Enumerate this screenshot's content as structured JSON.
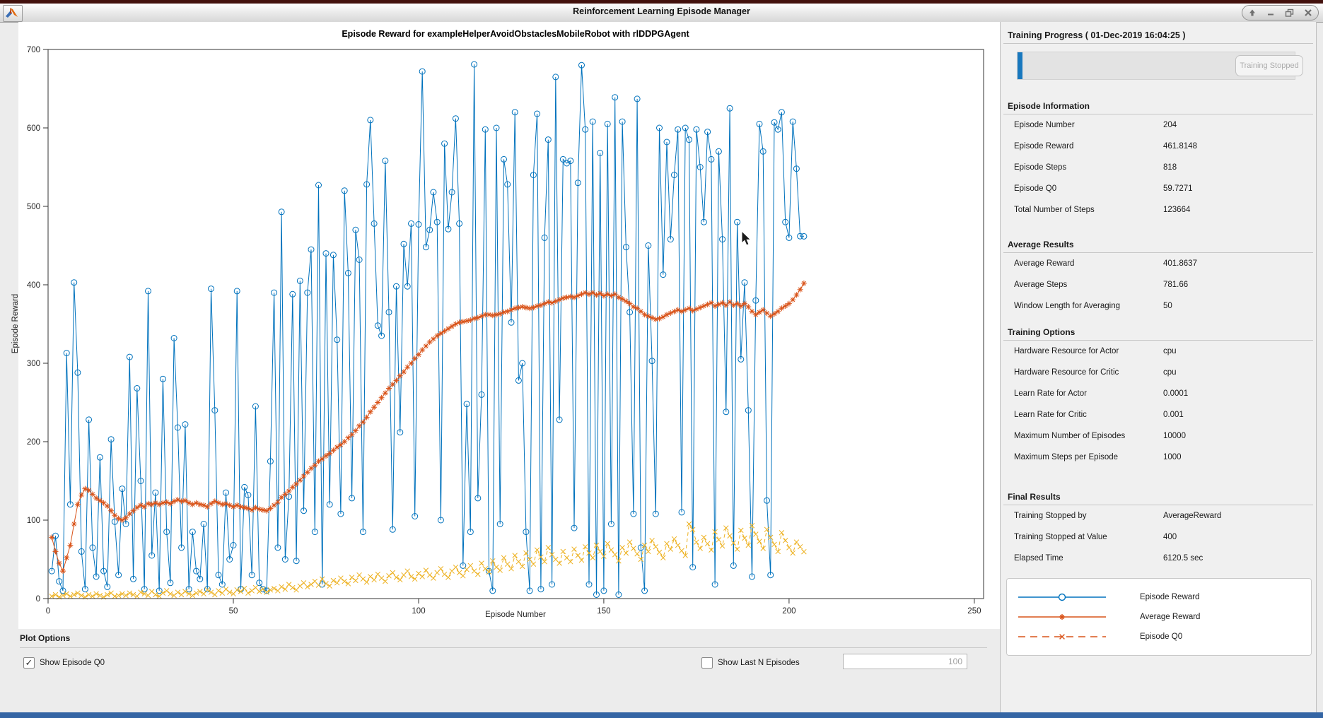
{
  "window": {
    "title": "Reinforcement Learning Episode Manager"
  },
  "chart": {
    "title": "Episode Reward for exampleHelperAvoidObstaclesMobileRobot with rlDDPGAgent",
    "xlabel": "Episode Number",
    "ylabel": "Episode Reward"
  },
  "chart_data": {
    "type": "line",
    "title": "Episode Reward for exampleHelperAvoidObstaclesMobileRobot with rlDDPGAgent",
    "xlabel": "Episode Number",
    "ylabel": "Episode Reward",
    "xlim": [
      0,
      252.5
    ],
    "ylim": [
      0,
      700
    ],
    "xticks": [
      0,
      50,
      100,
      150,
      200,
      250
    ],
    "yticks": [
      0,
      100,
      200,
      300,
      400,
      500,
      600,
      700
    ],
    "grid": false,
    "legend_position": "right-panel",
    "series": [
      {
        "name": "Episode Reward",
        "color": "#0072BD",
        "marker": "circle",
        "style": "solid",
        "values": [
          35,
          80,
          22,
          10,
          313,
          120,
          403,
          288,
          60,
          12,
          228,
          65,
          28,
          180,
          35,
          15,
          203,
          98,
          30,
          140,
          95,
          308,
          25,
          268,
          150,
          12,
          392,
          55,
          135,
          10,
          280,
          85,
          20,
          332,
          218,
          65,
          222,
          12,
          85,
          35,
          25,
          95,
          12,
          395,
          240,
          30,
          18,
          135,
          50,
          68,
          392,
          12,
          142,
          132,
          30,
          245,
          20,
          12,
          10,
          175,
          390,
          65,
          493,
          50,
          130,
          388,
          48,
          405,
          112,
          390,
          445,
          85,
          527,
          18,
          440,
          120,
          438,
          330,
          108,
          520,
          415,
          128,
          470,
          432,
          85,
          528,
          610,
          478,
          348,
          335,
          558,
          365,
          88,
          398,
          212,
          452,
          398,
          478,
          105,
          477,
          672,
          448,
          470,
          518,
          480,
          100,
          580,
          471,
          518,
          612,
          478,
          42,
          248,
          85,
          681,
          128,
          260,
          598,
          35,
          10,
          600,
          95,
          560,
          528,
          352,
          620,
          278,
          300,
          85,
          10,
          540,
          618,
          12,
          460,
          585,
          18,
          665,
          228,
          560,
          555,
          558,
          90,
          530,
          680,
          598,
          18,
          608,
          5,
          568,
          10,
          605,
          95,
          639,
          5,
          608,
          448,
          365,
          108,
          637,
          65,
          10,
          450,
          303,
          108,
          600,
          413,
          582,
          458,
          540,
          598,
          110,
          600,
          585,
          40,
          598,
          550,
          480,
          595,
          560,
          18,
          570,
          458,
          238,
          625,
          42,
          480,
          305,
          403,
          240,
          28,
          380,
          605,
          570,
          125,
          30,
          607,
          598,
          620,
          480,
          460,
          608,
          548,
          462,
          461.8148
        ]
      },
      {
        "name": "Average Reward",
        "color": "#D95319",
        "marker": "asterisk",
        "style": "solid",
        "values": [
          78,
          60,
          45,
          35,
          52,
          68,
          95,
          120,
          132,
          140,
          138,
          133,
          128,
          125,
          122,
          118,
          112,
          106,
          102,
          100,
          103,
          108,
          112,
          116,
          119,
          117,
          121,
          120,
          122,
          120,
          122,
          123,
          121,
          124,
          126,
          124,
          125,
          122,
          120,
          122,
          120,
          119,
          117,
          121,
          124,
          122,
          120,
          121,
          119,
          117,
          119,
          117,
          116,
          115,
          113,
          116,
          114,
          113,
          112,
          115,
          119,
          123,
          129,
          133,
          137,
          142,
          146,
          151,
          156,
          161,
          166,
          170,
          175,
          178,
          182,
          185,
          189,
          193,
          196,
          200,
          205,
          209,
          214,
          220,
          225,
          231,
          238,
          244,
          250,
          256,
          262,
          268,
          273,
          278,
          284,
          289,
          295,
          300,
          306,
          311,
          317,
          322,
          327,
          331,
          335,
          338,
          341,
          344,
          347,
          350,
          352,
          353,
          354,
          355,
          357,
          358,
          360,
          362,
          362,
          361,
          362,
          363,
          365,
          366,
          368,
          370,
          371,
          372,
          371,
          370,
          371,
          373,
          374,
          376,
          378,
          377,
          379,
          381,
          383,
          384,
          385,
          384,
          386,
          388,
          390,
          388,
          390,
          387,
          389,
          386,
          388,
          386,
          388,
          384,
          382,
          379,
          376,
          372,
          370,
          366,
          362,
          360,
          358,
          356,
          357,
          359,
          362,
          364,
          366,
          368,
          366,
          368,
          370,
          367,
          369,
          371,
          373,
          375,
          377,
          373,
          375,
          377,
          374,
          378,
          374,
          376,
          373,
          376,
          372,
          366,
          362,
          365,
          368,
          364,
          360,
          363,
          366,
          370,
          373,
          376,
          381,
          387,
          394,
          401.8637
        ]
      },
      {
        "name": "Episode Q0",
        "color": "#EDB120",
        "marker": "x",
        "style": "dashed",
        "values": [
          3,
          5,
          2,
          4,
          6,
          3,
          5,
          7,
          4,
          2,
          5,
          3,
          6,
          4,
          2,
          5,
          7,
          3,
          4,
          6,
          4,
          7,
          5,
          3,
          8,
          6,
          4,
          9,
          5,
          3,
          7,
          10,
          6,
          4,
          8,
          5,
          9,
          6,
          4,
          7,
          9,
          6,
          11,
          8,
          5,
          10,
          7,
          12,
          8,
          6,
          11,
          9,
          13,
          7,
          10,
          14,
          9,
          12,
          8,
          11,
          13,
          10,
          15,
          12,
          18,
          14,
          11,
          16,
          20,
          15,
          18,
          22,
          17,
          25,
          19,
          16,
          23,
          20,
          26,
          22,
          19,
          27,
          23,
          30,
          25,
          21,
          28,
          24,
          31,
          26,
          22,
          29,
          33,
          27,
          24,
          30,
          35,
          28,
          25,
          32,
          28,
          36,
          30,
          26,
          33,
          38,
          31,
          27,
          35,
          40,
          33,
          29,
          37,
          42,
          35,
          31,
          45,
          38,
          34,
          48,
          40,
          36,
          52,
          44,
          38,
          55,
          47,
          41,
          58,
          50,
          44,
          62,
          53,
          47,
          65,
          56,
          50,
          45,
          60,
          52,
          47,
          63,
          55,
          49,
          66,
          58,
          52,
          68,
          60,
          54,
          70,
          62,
          56,
          48,
          65,
          58,
          72,
          64,
          57,
          50,
          68,
          60,
          74,
          66,
          59,
          52,
          70,
          63,
          76,
          68,
          61,
          55,
          95,
          88,
          72,
          64,
          78,
          70,
          62,
          85,
          75,
          67,
          90,
          80,
          71,
          63,
          87,
          77,
          68,
          93,
          82,
          73,
          64,
          88,
          78,
          69,
          60,
          84,
          74,
          65,
          58,
          72,
          66,
          59.7271
        ]
      }
    ]
  },
  "plot_options": {
    "header": "Plot Options",
    "show_episode_q0": {
      "label": "Show Episode Q0",
      "checked": true
    },
    "show_last_n": {
      "label": "Show Last N Episodes",
      "checked": false
    },
    "n_value": "100"
  },
  "panel": {
    "header": "Training Progress ( 01-Dec-2019 16:04:25 )",
    "progress_button": "Training Stopped",
    "sections": [
      {
        "title": "Episode Information",
        "rows": [
          [
            "Episode Number",
            "204"
          ],
          [
            "Episode Reward",
            "461.8148"
          ],
          [
            "Episode Steps",
            "818"
          ],
          [
            "Episode Q0",
            "59.7271"
          ],
          [
            "Total Number of Steps",
            "123664"
          ]
        ]
      },
      {
        "title": "Average Results",
        "rows": [
          [
            "Average Reward",
            "401.8637"
          ],
          [
            "Average Steps",
            "781.66"
          ],
          [
            "Window Length for Averaging",
            "50"
          ]
        ]
      },
      {
        "title": "Training Options",
        "rows": [
          [
            "Hardware Resource for Actor",
            "cpu"
          ],
          [
            "Hardware Resource for Critic",
            "cpu"
          ],
          [
            "Learn Rate for Actor",
            "0.0001"
          ],
          [
            "Learn Rate for Critic",
            "0.001"
          ],
          [
            "Maximum Number of Episodes",
            "10000"
          ],
          [
            "Maximum Steps per Episode",
            "1000"
          ]
        ]
      },
      {
        "title": "Final Results",
        "rows": [
          [
            "Training Stopped by",
            "AverageReward"
          ],
          [
            "Training Stopped at Value",
            "400"
          ],
          [
            "Elapsed Time",
            "6120.5 sec"
          ]
        ]
      }
    ],
    "legend": [
      {
        "label": "Episode Reward",
        "color": "#0072BD",
        "marker": "circle",
        "style": "solid"
      },
      {
        "label": "Average Reward",
        "color": "#D95319",
        "marker": "asterisk",
        "style": "solid"
      },
      {
        "label": "Episode Q0",
        "color": "#D95319",
        "marker": "x",
        "style": "dashed"
      }
    ]
  },
  "colors": {
    "episode_reward": "#0072BD",
    "average_reward": "#D95319",
    "episode_q0": "#EDB120",
    "progress_fill": "#1878be"
  }
}
